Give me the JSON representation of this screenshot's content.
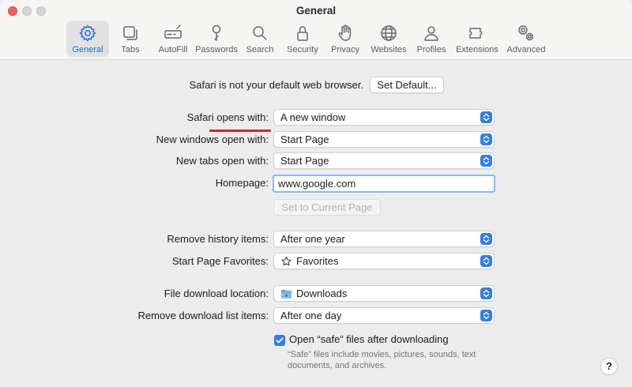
{
  "window": {
    "title": "General"
  },
  "toolbar": {
    "tabs": [
      {
        "label": "General",
        "icon": "gear-icon",
        "active": true
      },
      {
        "label": "Tabs",
        "icon": "tabs-icon"
      },
      {
        "label": "AutoFill",
        "icon": "autofill-icon"
      },
      {
        "label": "Passwords",
        "icon": "key-icon"
      },
      {
        "label": "Search",
        "icon": "search-icon"
      },
      {
        "label": "Security",
        "icon": "lock-icon"
      },
      {
        "label": "Privacy",
        "icon": "hand-icon"
      },
      {
        "label": "Websites",
        "icon": "globe-icon"
      },
      {
        "label": "Profiles",
        "icon": "person-icon"
      },
      {
        "label": "Extensions",
        "icon": "puzzle-icon"
      },
      {
        "label": "Advanced",
        "icon": "gears-icon"
      }
    ]
  },
  "default_browser": {
    "message": "Safari is not your default web browser.",
    "button": "Set Default..."
  },
  "settings": {
    "opens_with": {
      "label": "Safari opens with:",
      "value": "A new window"
    },
    "new_windows": {
      "label": "New windows open with:",
      "value": "Start Page"
    },
    "new_tabs": {
      "label": "New tabs open with:",
      "value": "Start Page"
    },
    "homepage": {
      "label": "Homepage:",
      "value": "www.google.com",
      "button": "Set to Current Page"
    },
    "history": {
      "label": "Remove history items:",
      "value": "After one year"
    },
    "favorites": {
      "label": "Start Page Favorites:",
      "value": "Favorites",
      "icon": "star-icon"
    },
    "download_location": {
      "label": "File download location:",
      "value": "Downloads",
      "icon": "folder-icon"
    },
    "download_list": {
      "label": "Remove download list items:",
      "value": "After one day"
    },
    "safe_files": {
      "label": "Open “safe” files after downloading",
      "checked": true,
      "help": "“Safe” files include movies, pictures, sounds, text documents, and archives."
    }
  },
  "help_button": "?",
  "colors": {
    "accent": "#2f7cf6",
    "annotation": "#d4262c",
    "close": "#ff5f57"
  }
}
